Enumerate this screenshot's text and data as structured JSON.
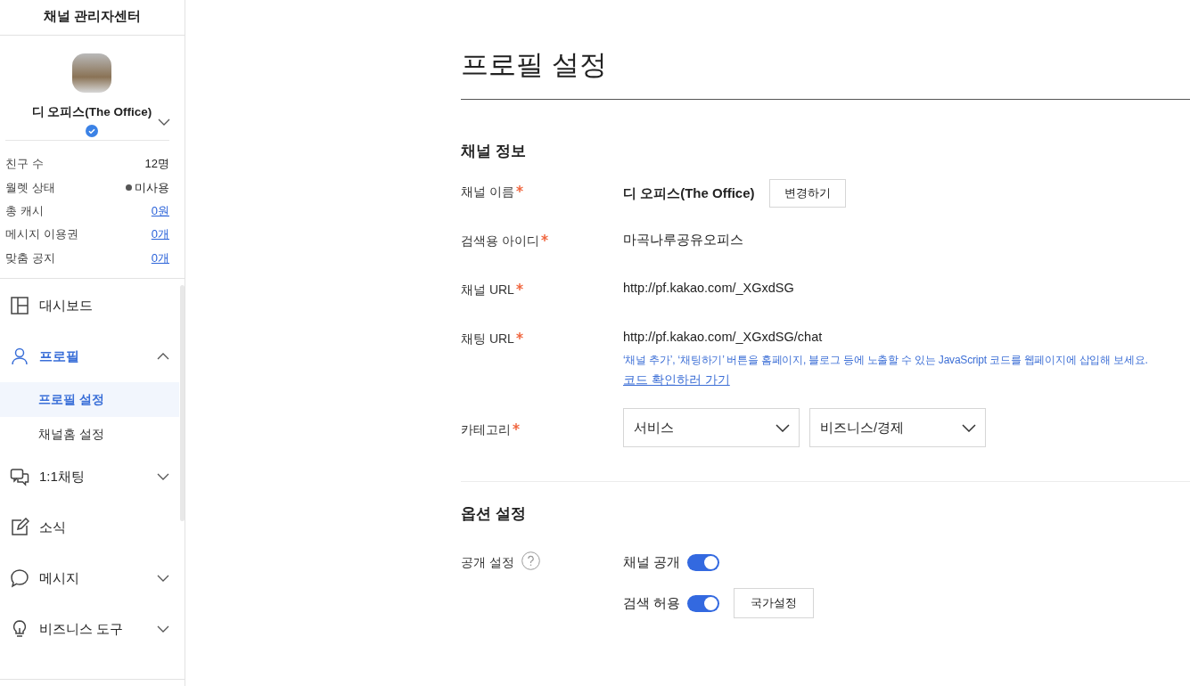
{
  "sidebar": {
    "title": "채널 관리자센터",
    "profile": {
      "name": "디 오피스(The Office)",
      "verified": true
    },
    "stats": [
      {
        "label": "친구 수",
        "value": "12명",
        "kind": "plain"
      },
      {
        "label": "월렛 상태",
        "value": "미사용",
        "kind": "status",
        "active": false
      },
      {
        "label": "총 캐시",
        "value": "0원",
        "kind": "link"
      },
      {
        "label": "메시지 이용권",
        "value": "0개",
        "kind": "link"
      },
      {
        "label": "맞춤 공지",
        "value": "0개",
        "kind": "link"
      }
    ],
    "nav": [
      {
        "label": "대시보드",
        "selected": false
      },
      {
        "label": "프로필",
        "selected": true,
        "expanded": true,
        "children": [
          {
            "label": "프로필 설정",
            "selected": true
          },
          {
            "label": "채널홈 설정",
            "selected": false
          }
        ]
      },
      {
        "label": "1:1채팅",
        "selected": false,
        "expanded": false
      },
      {
        "label": "소식",
        "selected": false
      },
      {
        "label": "메시지",
        "selected": false,
        "expanded": false
      },
      {
        "label": "비즈니스 도구",
        "selected": false,
        "expanded": false
      }
    ]
  },
  "page": {
    "title": "프로필 설정",
    "sections": [
      {
        "heading": "채널 정보",
        "fields": [
          {
            "kind": "name",
            "label": "채널 이름",
            "required": true,
            "value": "디 오피스(The Office)",
            "button": "변경하기"
          },
          {
            "kind": "text",
            "label": "검색용 아이디",
            "required": true,
            "value": "마곡나루공유오피스"
          },
          {
            "kind": "text",
            "label": "채널 URL",
            "required": true,
            "value": "http://pf.kakao.com/_XGxdSG"
          },
          {
            "kind": "url",
            "label": "채팅 URL",
            "required": true,
            "value": "http://pf.kakao.com/_XGxdSG/chat",
            "hint": "‘채널 추가’, ‘채팅하기’ 버튼을 홈페이지, 블로그 등에 노출할 수 있는 JavaScript 코드를 웹페이지에 삽입해 보세요.",
            "link": "코드 확인하러 가기"
          },
          {
            "kind": "select",
            "label": "카테고리",
            "required": true,
            "options": [
              "서비스",
              "비즈니스/경제"
            ]
          }
        ]
      },
      {
        "heading": "옵션 설정",
        "fields": [
          {
            "kind": "toggles",
            "label": "공개 설정",
            "help": true,
            "toggles": [
              {
                "label": "채널 공개",
                "on": true
              },
              {
                "label": "검색 허용",
                "on": true,
                "button": "국가설정"
              }
            ]
          }
        ]
      }
    ]
  }
}
